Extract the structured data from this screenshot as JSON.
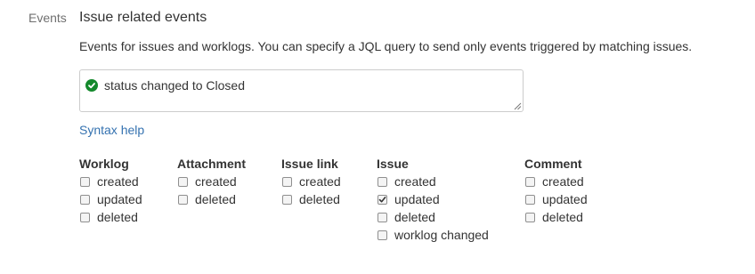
{
  "section": {
    "label": "Events",
    "title": "Issue related events",
    "description": "Events for issues and worklogs. You can specify a JQL query to send only events triggered by matching issues."
  },
  "jql": {
    "value": "status changed to Closed",
    "status_icon": "check-circle-icon",
    "status_color": "#14892c"
  },
  "syntax_help": "Syntax help",
  "link_color": "#3572b0",
  "groups": [
    {
      "title": "Worklog",
      "options": [
        {
          "label": "created",
          "checked": false
        },
        {
          "label": "updated",
          "checked": false
        },
        {
          "label": "deleted",
          "checked": false
        }
      ]
    },
    {
      "title": "Attachment",
      "options": [
        {
          "label": "created",
          "checked": false
        },
        {
          "label": "deleted",
          "checked": false
        }
      ]
    },
    {
      "title": "Issue link",
      "options": [
        {
          "label": "created",
          "checked": false
        },
        {
          "label": "deleted",
          "checked": false
        }
      ]
    },
    {
      "title": "Issue",
      "options": [
        {
          "label": "created",
          "checked": false
        },
        {
          "label": "updated",
          "checked": true
        },
        {
          "label": "deleted",
          "checked": false
        },
        {
          "label": "worklog changed",
          "checked": false
        }
      ]
    },
    {
      "title": "Comment",
      "options": [
        {
          "label": "created",
          "checked": false
        },
        {
          "label": "updated",
          "checked": false
        },
        {
          "label": "deleted",
          "checked": false
        }
      ]
    }
  ]
}
